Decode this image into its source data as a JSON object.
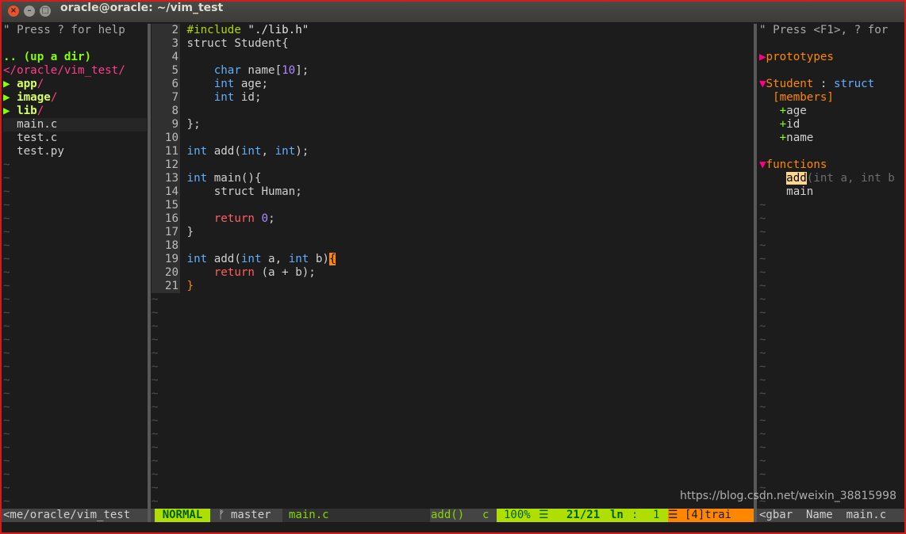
{
  "window": {
    "title": "oracle@oracle: ~/vim_test",
    "close_glyph": "×",
    "min_glyph": "–",
    "max_glyph": "□"
  },
  "nerdtree": {
    "help": "\" Press ? for help",
    "up_dir": ".. (up a dir)",
    "cwd": "</oracle/vim_test/",
    "dirs": [
      {
        "arrow": "▶",
        "name": "app",
        "slash": "/"
      },
      {
        "arrow": "▶",
        "name": "image",
        "slash": "/"
      },
      {
        "arrow": "▶",
        "name": "lib",
        "slash": "/"
      }
    ],
    "files": [
      "main.c",
      "test.c",
      "test.py"
    ],
    "status": "<me/oracle/vim_test"
  },
  "editor": {
    "lines": [
      {
        "n": "2"
      },
      {
        "n": "3"
      },
      {
        "n": "4"
      },
      {
        "n": "5"
      },
      {
        "n": "6"
      },
      {
        "n": "7"
      },
      {
        "n": "8"
      },
      {
        "n": "9"
      },
      {
        "n": "10"
      },
      {
        "n": "11"
      },
      {
        "n": "12"
      },
      {
        "n": "13"
      },
      {
        "n": "14"
      },
      {
        "n": "15"
      },
      {
        "n": "16"
      },
      {
        "n": "17"
      },
      {
        "n": "18"
      },
      {
        "n": "19"
      },
      {
        "n": "20"
      },
      {
        "n": "21"
      }
    ],
    "code": {
      "l2a": "#include",
      "l2b": " \"./lib.h\"",
      "l3": "struct Student{",
      "l5a": "    ",
      "l5b": "char",
      "l5c": " name[",
      "l5d": "10",
      "l5e": "];",
      "l6a": "int",
      "l6b": " age;",
      "l7a": "int",
      "l7b": " id;",
      "l9": "};",
      "l11a": "int",
      "l11b": " add(",
      "l11c": "int",
      "l11d": ", ",
      "l11e": "int",
      "l11f": ");",
      "l13a": "int",
      "l13b": " main(){",
      "l14a": "struct",
      "l14b": " Human;",
      "l16a": "return",
      "l16b": " ",
      "l16c": "0",
      "l16d": ";",
      "l17": "}",
      "l19a": "int",
      "l19b": " add(",
      "l19c": "int",
      "l19d": " a, ",
      "l19e": "int",
      "l19f": " b)",
      "l19g": "{",
      "l20a": "return",
      "l20b": " (a + b);",
      "l21": "}"
    }
  },
  "tagbar": {
    "help": "\" Press <F1>, ? for",
    "proto_arrow": "▶",
    "prototypes": "prototypes",
    "struct_arrow": "▼",
    "struct_name": "Student",
    "struct_sep": " : ",
    "struct_kw": "struct",
    "members_label": "[members]",
    "members": [
      {
        "plus": "+",
        "name": "age"
      },
      {
        "plus": "+",
        "name": "id"
      },
      {
        "plus": "+",
        "name": "name"
      }
    ],
    "func_arrow": "▼",
    "functions": "functions",
    "func1": "add",
    "func1_args": "(int a, int b",
    "func2": "main",
    "status": "<gbar  Name  main.c"
  },
  "statusline": {
    "mode": "NORMAL",
    "branch_icon": "ᚠ",
    "branch": "master",
    "file": "main.c",
    "func": "add()",
    "ft": "c",
    "percent": "100%",
    "lines_icon": "☰",
    "position": "21/21",
    "ln_label": "ln",
    "col_sep": ":",
    "col": "1",
    "warn": "☰ [4]trai"
  },
  "watermark": "https://blog.csdn.net/weixin_38815998"
}
